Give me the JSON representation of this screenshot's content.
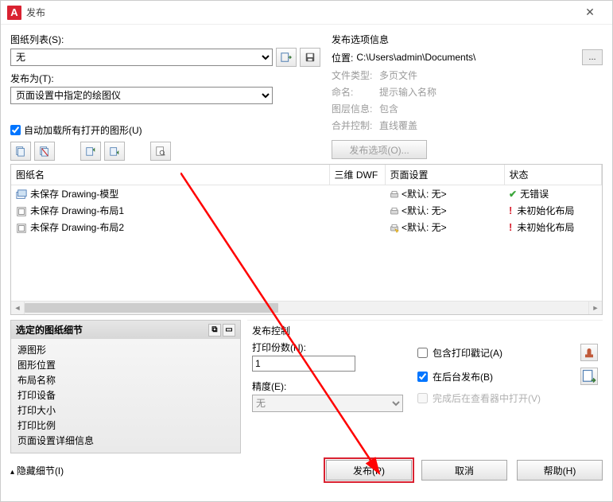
{
  "title": "发布",
  "left": {
    "sheet_list_label": "图纸列表(S):",
    "sheet_list_value": "无",
    "publish_as_label": "发布为(T):",
    "publish_as_value": "页面设置中指定的绘图仪",
    "autoload_label": "自动加载所有打开的图形(U)"
  },
  "right": {
    "header": "发布选项信息",
    "location_label": "位置:",
    "location_value": "C:\\Users\\admin\\Documents\\",
    "filetype_label": "文件类型:",
    "filetype_value": "多页文件",
    "naming_label": "命名:",
    "naming_value": "提示输入名称",
    "layers_label": "图层信息:",
    "layers_value": "包含",
    "merge_label": "合并控制:",
    "merge_value": "直线覆盖",
    "options_btn": "发布选项(O)..."
  },
  "grid": {
    "cols": {
      "name": "图纸名",
      "three_d": "三维 DWF",
      "page": "页面设置",
      "status": "状态"
    },
    "rows": [
      {
        "name": "未保存 Drawing-模型",
        "page": "<默认: 无>",
        "status": "无错误",
        "status_ok": true
      },
      {
        "name": "未保存 Drawing-布局1",
        "page": "<默认: 无>",
        "status": "未初始化布局",
        "status_ok": false
      },
      {
        "name": "未保存 Drawing-布局2",
        "page": "<默认: 无>",
        "status": "未初始化布局",
        "status_ok": false
      }
    ]
  },
  "detail": {
    "header": "选定的图纸细节",
    "items": [
      "源图形",
      "图形位置",
      "布局名称",
      "打印设备",
      "打印大小",
      "打印比例",
      "页面设置详细信息"
    ]
  },
  "pubctrl": {
    "header": "发布控制",
    "copies_label": "打印份数(N):",
    "copies_value": "1",
    "precision_label": "精度(E):",
    "precision_value": "无",
    "include_stamp": "包含打印戳记(A)",
    "bg_publish": "在后台发布(B)",
    "open_after": "完成后在查看器中打开(V)"
  },
  "footer": {
    "hide": "隐藏细节(I)",
    "publish": "发布(P)",
    "cancel": "取消",
    "help": "帮助(H)"
  }
}
